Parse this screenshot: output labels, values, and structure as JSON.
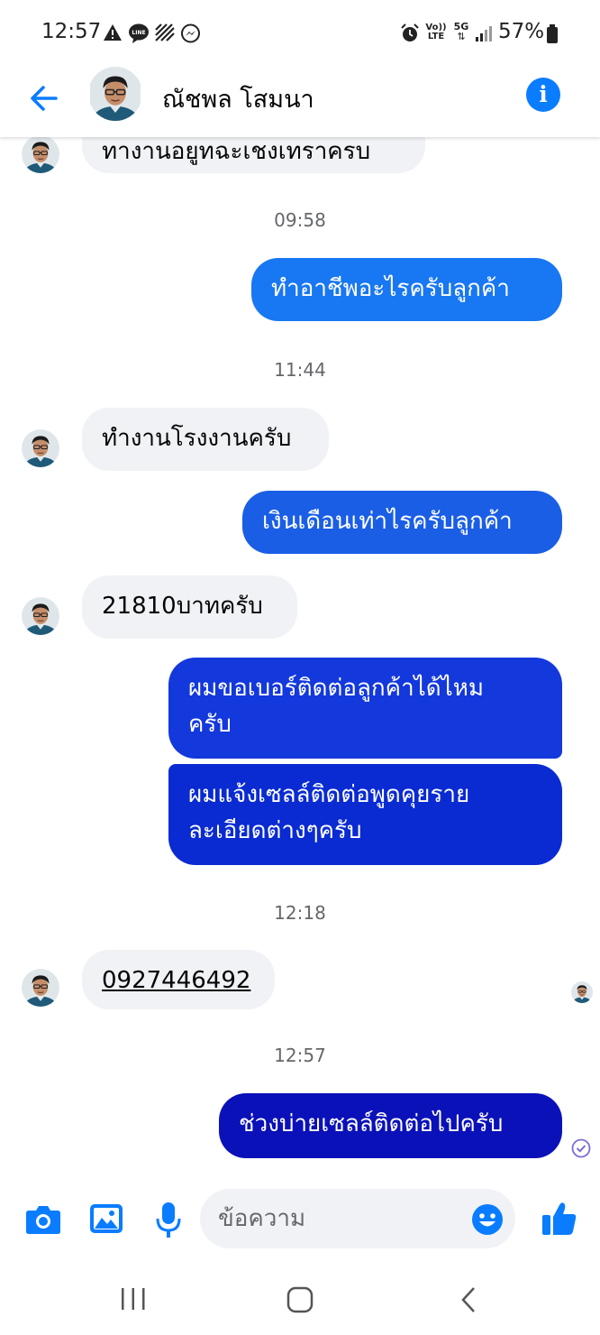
{
  "status_bar": {
    "time": "12:57",
    "battery_percent": "57%",
    "network": "5G",
    "volte_line1": "Vo))",
    "volte_line2": "LTE",
    "icons": [
      "warning-icon",
      "line-app-icon",
      "no-signal-icon",
      "messenger-icon",
      "alarm-icon",
      "volte-icon",
      "5g-icon",
      "signal-icon",
      "battery-icon"
    ]
  },
  "header": {
    "contact_name": "ณัชพล โสมนา",
    "back_icon": "arrow-left-icon",
    "info_icon": "info-icon",
    "info_label": "i"
  },
  "colors": {
    "accent": "#0a7cff",
    "incoming_bubble": "#f0f2f5",
    "outgoing_gradient": [
      "#0a7cff",
      "#1a3be0",
      "#0019c8",
      "#0000b5"
    ],
    "timestamp": "#65676b"
  },
  "messages": [
    {
      "type": "in",
      "text": "ทางานอยูทฉะเชงเทราครบ"
    },
    {
      "type": "time",
      "text": "09:58"
    },
    {
      "type": "out",
      "text": "ทำอาชีพอะไรครับลูกค้า"
    },
    {
      "type": "time",
      "text": "11:44"
    },
    {
      "type": "in",
      "text": "ทำงานโรงงานครับ"
    },
    {
      "type": "out",
      "text": "เงินเดือนเท่าไรครับลูกค้า"
    },
    {
      "type": "in",
      "text": "21810บาทครับ"
    },
    {
      "type": "out",
      "text_line1": "ผมขอเบอร์ติดต่อลูกค้าได้ไหม",
      "text_line2": "ครับ"
    },
    {
      "type": "out",
      "text_line1": "ผมแจ้งเซลล์ติดต่อพูดคุยราย",
      "text_line2": "ละเอียดต่างๆครับ"
    },
    {
      "type": "time",
      "text": "12:18"
    },
    {
      "type": "in",
      "text": "0927446492",
      "link": true
    },
    {
      "type": "time",
      "text": "12:57"
    },
    {
      "type": "out",
      "text": "ช่วงบ่ายเซลล์ติดต่อไปครับ",
      "status": "sent-check-icon"
    }
  ],
  "composer": {
    "placeholder": "ข้อความ",
    "icons": [
      "camera-icon",
      "gallery-icon",
      "microphone-icon",
      "emoji-icon",
      "thumbs-up-icon"
    ]
  },
  "nav_bar": {
    "icons": [
      "recent-apps-icon",
      "home-icon",
      "back-icon"
    ]
  }
}
